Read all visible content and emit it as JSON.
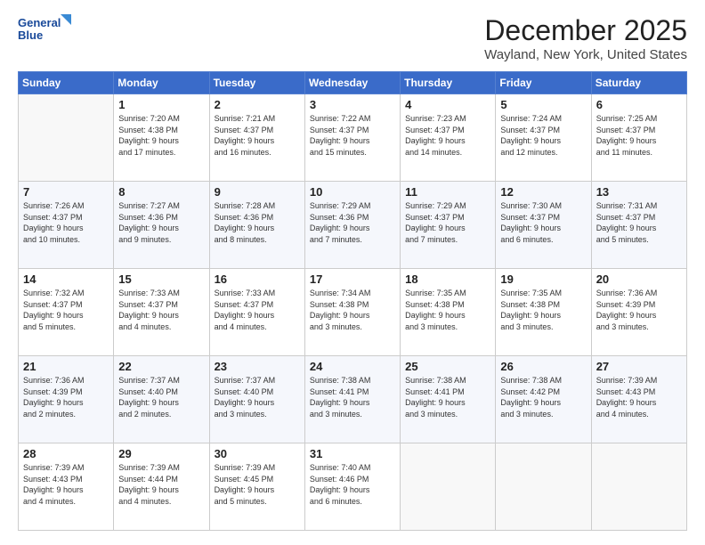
{
  "logo": {
    "line1": "General",
    "line2": "Blue"
  },
  "title": "December 2025",
  "subtitle": "Wayland, New York, United States",
  "days_of_week": [
    "Sunday",
    "Monday",
    "Tuesday",
    "Wednesday",
    "Thursday",
    "Friday",
    "Saturday"
  ],
  "weeks": [
    [
      {
        "num": "",
        "info": ""
      },
      {
        "num": "1",
        "info": "Sunrise: 7:20 AM\nSunset: 4:38 PM\nDaylight: 9 hours\nand 17 minutes."
      },
      {
        "num": "2",
        "info": "Sunrise: 7:21 AM\nSunset: 4:37 PM\nDaylight: 9 hours\nand 16 minutes."
      },
      {
        "num": "3",
        "info": "Sunrise: 7:22 AM\nSunset: 4:37 PM\nDaylight: 9 hours\nand 15 minutes."
      },
      {
        "num": "4",
        "info": "Sunrise: 7:23 AM\nSunset: 4:37 PM\nDaylight: 9 hours\nand 14 minutes."
      },
      {
        "num": "5",
        "info": "Sunrise: 7:24 AM\nSunset: 4:37 PM\nDaylight: 9 hours\nand 12 minutes."
      },
      {
        "num": "6",
        "info": "Sunrise: 7:25 AM\nSunset: 4:37 PM\nDaylight: 9 hours\nand 11 minutes."
      }
    ],
    [
      {
        "num": "7",
        "info": "Sunrise: 7:26 AM\nSunset: 4:37 PM\nDaylight: 9 hours\nand 10 minutes."
      },
      {
        "num": "8",
        "info": "Sunrise: 7:27 AM\nSunset: 4:36 PM\nDaylight: 9 hours\nand 9 minutes."
      },
      {
        "num": "9",
        "info": "Sunrise: 7:28 AM\nSunset: 4:36 PM\nDaylight: 9 hours\nand 8 minutes."
      },
      {
        "num": "10",
        "info": "Sunrise: 7:29 AM\nSunset: 4:36 PM\nDaylight: 9 hours\nand 7 minutes."
      },
      {
        "num": "11",
        "info": "Sunrise: 7:29 AM\nSunset: 4:37 PM\nDaylight: 9 hours\nand 7 minutes."
      },
      {
        "num": "12",
        "info": "Sunrise: 7:30 AM\nSunset: 4:37 PM\nDaylight: 9 hours\nand 6 minutes."
      },
      {
        "num": "13",
        "info": "Sunrise: 7:31 AM\nSunset: 4:37 PM\nDaylight: 9 hours\nand 5 minutes."
      }
    ],
    [
      {
        "num": "14",
        "info": "Sunrise: 7:32 AM\nSunset: 4:37 PM\nDaylight: 9 hours\nand 5 minutes."
      },
      {
        "num": "15",
        "info": "Sunrise: 7:33 AM\nSunset: 4:37 PM\nDaylight: 9 hours\nand 4 minutes."
      },
      {
        "num": "16",
        "info": "Sunrise: 7:33 AM\nSunset: 4:37 PM\nDaylight: 9 hours\nand 4 minutes."
      },
      {
        "num": "17",
        "info": "Sunrise: 7:34 AM\nSunset: 4:38 PM\nDaylight: 9 hours\nand 3 minutes."
      },
      {
        "num": "18",
        "info": "Sunrise: 7:35 AM\nSunset: 4:38 PM\nDaylight: 9 hours\nand 3 minutes."
      },
      {
        "num": "19",
        "info": "Sunrise: 7:35 AM\nSunset: 4:38 PM\nDaylight: 9 hours\nand 3 minutes."
      },
      {
        "num": "20",
        "info": "Sunrise: 7:36 AM\nSunset: 4:39 PM\nDaylight: 9 hours\nand 3 minutes."
      }
    ],
    [
      {
        "num": "21",
        "info": "Sunrise: 7:36 AM\nSunset: 4:39 PM\nDaylight: 9 hours\nand 2 minutes."
      },
      {
        "num": "22",
        "info": "Sunrise: 7:37 AM\nSunset: 4:40 PM\nDaylight: 9 hours\nand 2 minutes."
      },
      {
        "num": "23",
        "info": "Sunrise: 7:37 AM\nSunset: 4:40 PM\nDaylight: 9 hours\nand 3 minutes."
      },
      {
        "num": "24",
        "info": "Sunrise: 7:38 AM\nSunset: 4:41 PM\nDaylight: 9 hours\nand 3 minutes."
      },
      {
        "num": "25",
        "info": "Sunrise: 7:38 AM\nSunset: 4:41 PM\nDaylight: 9 hours\nand 3 minutes."
      },
      {
        "num": "26",
        "info": "Sunrise: 7:38 AM\nSunset: 4:42 PM\nDaylight: 9 hours\nand 3 minutes."
      },
      {
        "num": "27",
        "info": "Sunrise: 7:39 AM\nSunset: 4:43 PM\nDaylight: 9 hours\nand 4 minutes."
      }
    ],
    [
      {
        "num": "28",
        "info": "Sunrise: 7:39 AM\nSunset: 4:43 PM\nDaylight: 9 hours\nand 4 minutes."
      },
      {
        "num": "29",
        "info": "Sunrise: 7:39 AM\nSunset: 4:44 PM\nDaylight: 9 hours\nand 4 minutes."
      },
      {
        "num": "30",
        "info": "Sunrise: 7:39 AM\nSunset: 4:45 PM\nDaylight: 9 hours\nand 5 minutes."
      },
      {
        "num": "31",
        "info": "Sunrise: 7:40 AM\nSunset: 4:46 PM\nDaylight: 9 hours\nand 6 minutes."
      },
      {
        "num": "",
        "info": ""
      },
      {
        "num": "",
        "info": ""
      },
      {
        "num": "",
        "info": ""
      }
    ]
  ]
}
